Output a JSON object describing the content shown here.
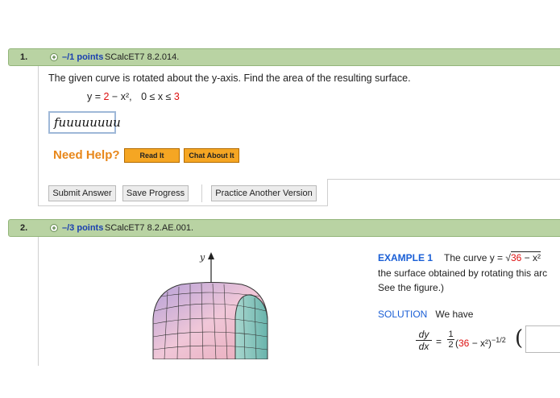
{
  "q1": {
    "number": "1.",
    "plus": "+",
    "points": "–/1 points",
    "code": "SCalcET7 8.2.014.",
    "prompt": "The given curve is rotated about the y-axis. Find the area of the resulting surface.",
    "eq_y": "y = ",
    "eq_a": "2",
    "eq_b": " − x², ",
    "eq_c": "0 ≤ x ≤ ",
    "eq_d": "3",
    "answer_value": "fuuuuuuuu",
    "need_help": "Need Help?",
    "read_it": "Read It",
    "chat_about_it": "Chat About It",
    "submit": "Submit Answer",
    "save": "Save Progress",
    "practice": "Practice Another Version"
  },
  "q2": {
    "number": "2.",
    "plus": "+",
    "points": "–/3 points",
    "code": "SCalcET7 8.2.AE.001.",
    "axis_label": "y",
    "example_label": "EXAMPLE 1",
    "example_text": "The curve y = √",
    "example_red": "36",
    "example_tail": " − x²",
    "line2": "the surface obtained by rotating this arc",
    "line3": "See the figure.)",
    "solution_label": "SOLUTION",
    "solution_text": "We have",
    "dy": "dy",
    "dx": "dx",
    "eq": "=",
    "half_num": "1",
    "half_den": "2",
    "deriv_open": "(",
    "deriv_red": "36",
    "deriv_tail": " − x²)",
    "deriv_exp": "−1/2",
    "big_paren": "("
  },
  "colors": {
    "bar": "#b9d3a3",
    "points": "#1a3fb0",
    "help": "#e8871a",
    "button": "#f5a623",
    "red": "#d11111"
  }
}
